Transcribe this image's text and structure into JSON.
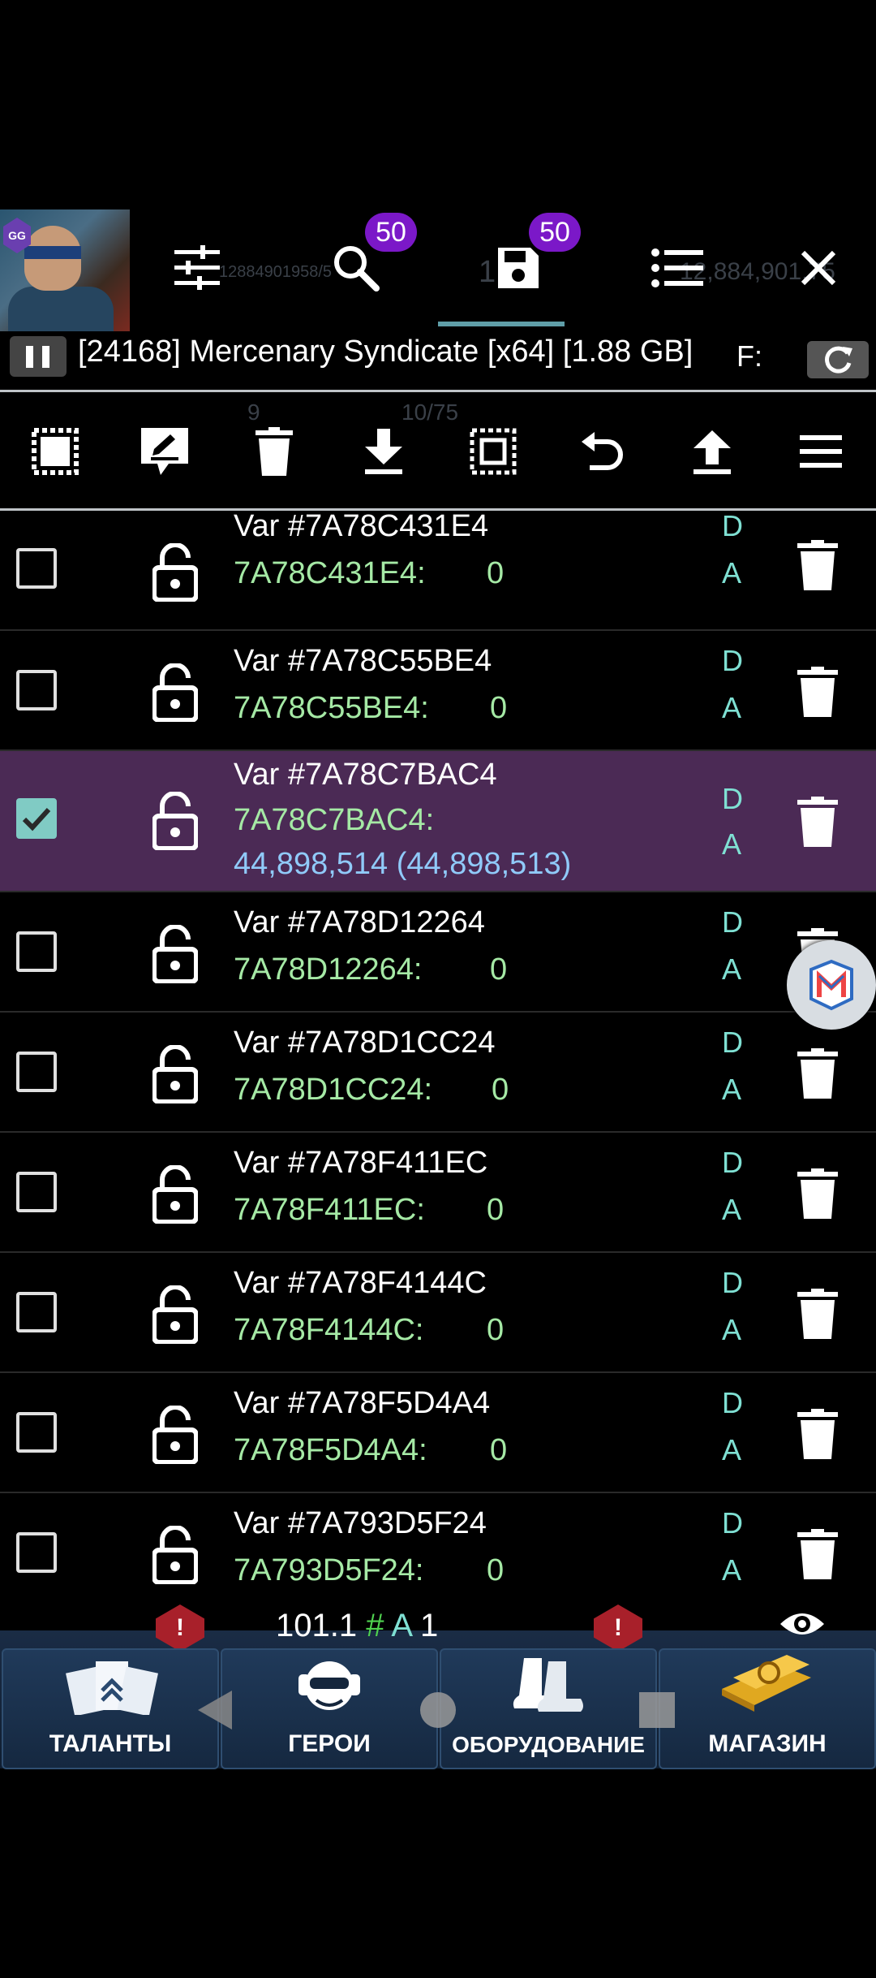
{
  "header": {
    "app_icon_name": "game-guardian-app-icon",
    "bg_text_left": "12884901958/5",
    "bg_text_mid": "1 7",
    "bg_text_right": "12,884,901,75",
    "badge_search": "50",
    "badge_saved": "50",
    "title": "[24168] Mercenary Syndicate [x64] [1.88 GB]",
    "f_label": "F:",
    "bg_numbers": {
      "level": "9",
      "xp": "10/75"
    }
  },
  "toolbar": {
    "items": [
      "select-all-icon",
      "edit-icon",
      "delete-icon",
      "download-icon",
      "invert-selection-icon",
      "undo-icon",
      "upload-icon",
      "menu-icon"
    ]
  },
  "rows": [
    {
      "name": "Var #7A78C431E4",
      "addr": "7A78C431E4:",
      "value": "0",
      "flag1": "D",
      "flag2": "A",
      "checked": false
    },
    {
      "name": "Var #7A78C55BE4",
      "addr": "7A78C55BE4:",
      "value": "0",
      "flag1": "D",
      "flag2": "A",
      "checked": false
    },
    {
      "name": "Var #7A78C7BAC4",
      "addr": "7A78C7BAC4:",
      "value": "44,898,514 (44,898,513)",
      "flag1": "D",
      "flag2": "A",
      "checked": true
    },
    {
      "name": "Var #7A78D12264",
      "addr": "7A78D12264:",
      "value": "0",
      "flag1": "D",
      "flag2": "A",
      "checked": false
    },
    {
      "name": "Var #7A78D1CC24",
      "addr": "7A78D1CC24:",
      "value": "0",
      "flag1": "D",
      "flag2": "A",
      "checked": false
    },
    {
      "name": "Var #7A78F411EC",
      "addr": "7A78F411EC:",
      "value": "0",
      "flag1": "D",
      "flag2": "A",
      "checked": false
    },
    {
      "name": "Var #7A78F4144C",
      "addr": "7A78F4144C:",
      "value": "0",
      "flag1": "D",
      "flag2": "A",
      "checked": false
    },
    {
      "name": "Var #7A78F5D4A4",
      "addr": "7A78F5D4A4:",
      "value": "0",
      "flag1": "D",
      "flag2": "A",
      "checked": false
    },
    {
      "name": "Var #7A793D5F24",
      "addr": "7A793D5F24:",
      "value": "0",
      "flag1": "D",
      "flag2": "A",
      "checked": false
    }
  ],
  "hud": {
    "value": "101.1",
    "hash": "#",
    "a": "A",
    "n": "1"
  },
  "gametabs": [
    "ТАЛАНТЫ",
    "ГЕРОИ",
    "ОБОРУДОВАНИЕ",
    "МАГАЗИН"
  ],
  "alerts": [
    "!",
    "!"
  ]
}
